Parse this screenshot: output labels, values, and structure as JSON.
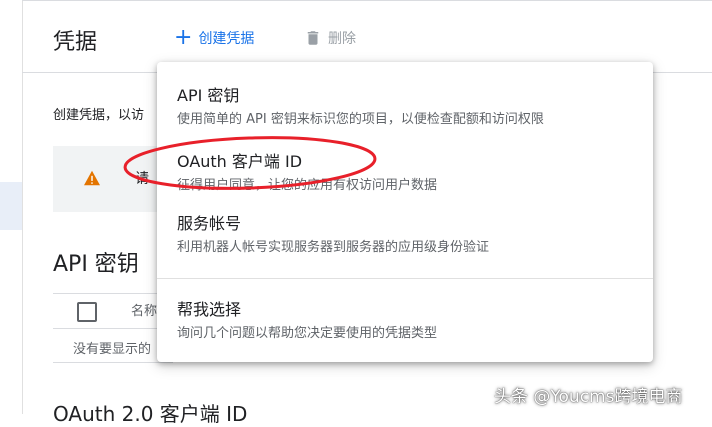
{
  "header": {
    "title": "凭据",
    "create_label": "创建凭据",
    "delete_label": "删除"
  },
  "main": {
    "intro": "创建凭据，以访",
    "warning_text": "请",
    "api_keys_heading": "API 密钥",
    "table": {
      "name_col": "名称"
    },
    "empty_text": "没有要显示的",
    "oauth_heading": "OAuth 2.0 客户端 ID"
  },
  "menu": {
    "items": [
      {
        "title": "API 密钥",
        "desc": "使用简单的 API 密钥来标识您的项目，以便检查配额和访问权限"
      },
      {
        "title": "OAuth 客户端 ID",
        "desc": "征得用户同意，让您的应用有权访问用户数据"
      },
      {
        "title": "服务帐号",
        "desc": "利用机器人帐号实现服务器到服务器的应用级身份验证"
      },
      {
        "title": "帮我选择",
        "desc": "询问几个问题以帮助您决定要使用的凭据类型"
      }
    ]
  },
  "annotation": {
    "color": "#e8202a",
    "highlighted": "OAuth 客户端 ID"
  },
  "watermark": "头条 @Youcms跨境电商",
  "colors": {
    "accent": "#1a73e8",
    "warning": "#e37400"
  }
}
